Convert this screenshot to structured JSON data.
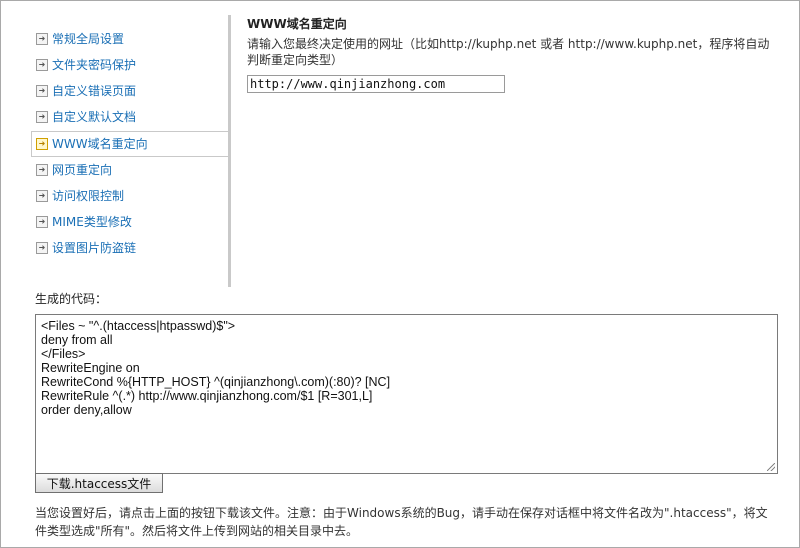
{
  "sidebar": {
    "items": [
      {
        "label": "常规全局设置",
        "active": false
      },
      {
        "label": "文件夹密码保护",
        "active": false
      },
      {
        "label": "自定义错误页面",
        "active": false
      },
      {
        "label": "自定义默认文档",
        "active": false
      },
      {
        "label": "WWW域名重定向",
        "active": true
      },
      {
        "label": "网页重定向",
        "active": false
      },
      {
        "label": "访问权限控制",
        "active": false
      },
      {
        "label": "MIME类型修改",
        "active": false
      },
      {
        "label": "设置图片防盗链",
        "active": false
      }
    ]
  },
  "main": {
    "title": "WWW域名重定向",
    "description": "请输入您最终决定使用的网址（比如http://kuphp.net 或者 http://www.kuphp.net，程序将自动判断重定向类型）",
    "url_value": "http://www.qinjianzhong.com"
  },
  "generated": {
    "label": "生成的代码：",
    "code_lines": [
      "<Files ~ \"^.(htaccess|htpasswd)$\">",
      "deny from all",
      "</Files>",
      "RewriteEngine on",
      "RewriteCond %{HTTP_HOST} ^(qinjianzhong\\.com)(:80)? [NC]",
      "RewriteRule ^(.*) http://www.qinjianzhong.com/$1 [R=301,L]",
      "order deny,allow"
    ],
    "download_label": "下载.htaccess文件"
  },
  "note": "当您设置好后，请点击上面的按钮下载该文件。注意：由于Windows系统的Bug，请手动在保存对话框中将文件名改为\".htaccess\"，将文件类型选成\"所有\"。然后将文件上传到网站的相关目录中去。"
}
